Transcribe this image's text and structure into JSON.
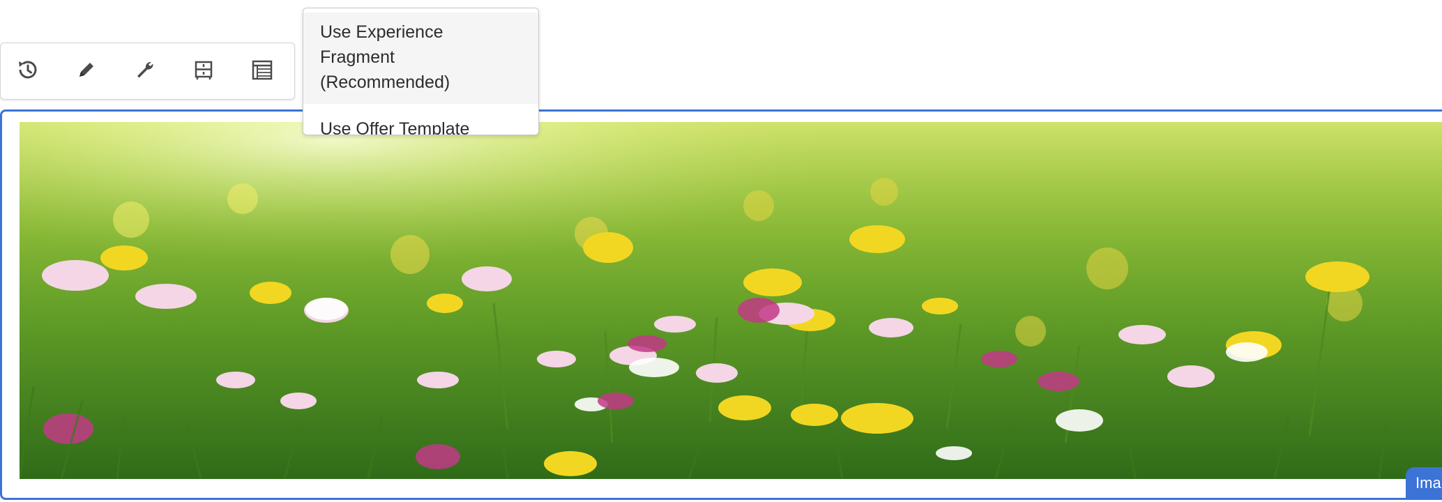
{
  "toolbar": {
    "buttons": [
      {
        "icon": "history-icon",
        "label": ""
      },
      {
        "icon": "pencil-icon",
        "label": ""
      },
      {
        "icon": "wrench-icon",
        "label": ""
      },
      {
        "icon": "target-activity-icon",
        "label": ""
      },
      {
        "icon": "table-icon",
        "label": ""
      }
    ]
  },
  "menu": {
    "items": [
      {
        "label": "Use Experience Fragment (Recommended)"
      },
      {
        "label": "Use Offer Template"
      }
    ]
  },
  "component": {
    "badge_label": "Ima",
    "image_subject": "meadow of daisies and dandelions"
  },
  "colors": {
    "selection_blue": "#3b73d6",
    "menu_highlight": "#f5f5f5",
    "icon_gray": "#4b4b4b"
  }
}
